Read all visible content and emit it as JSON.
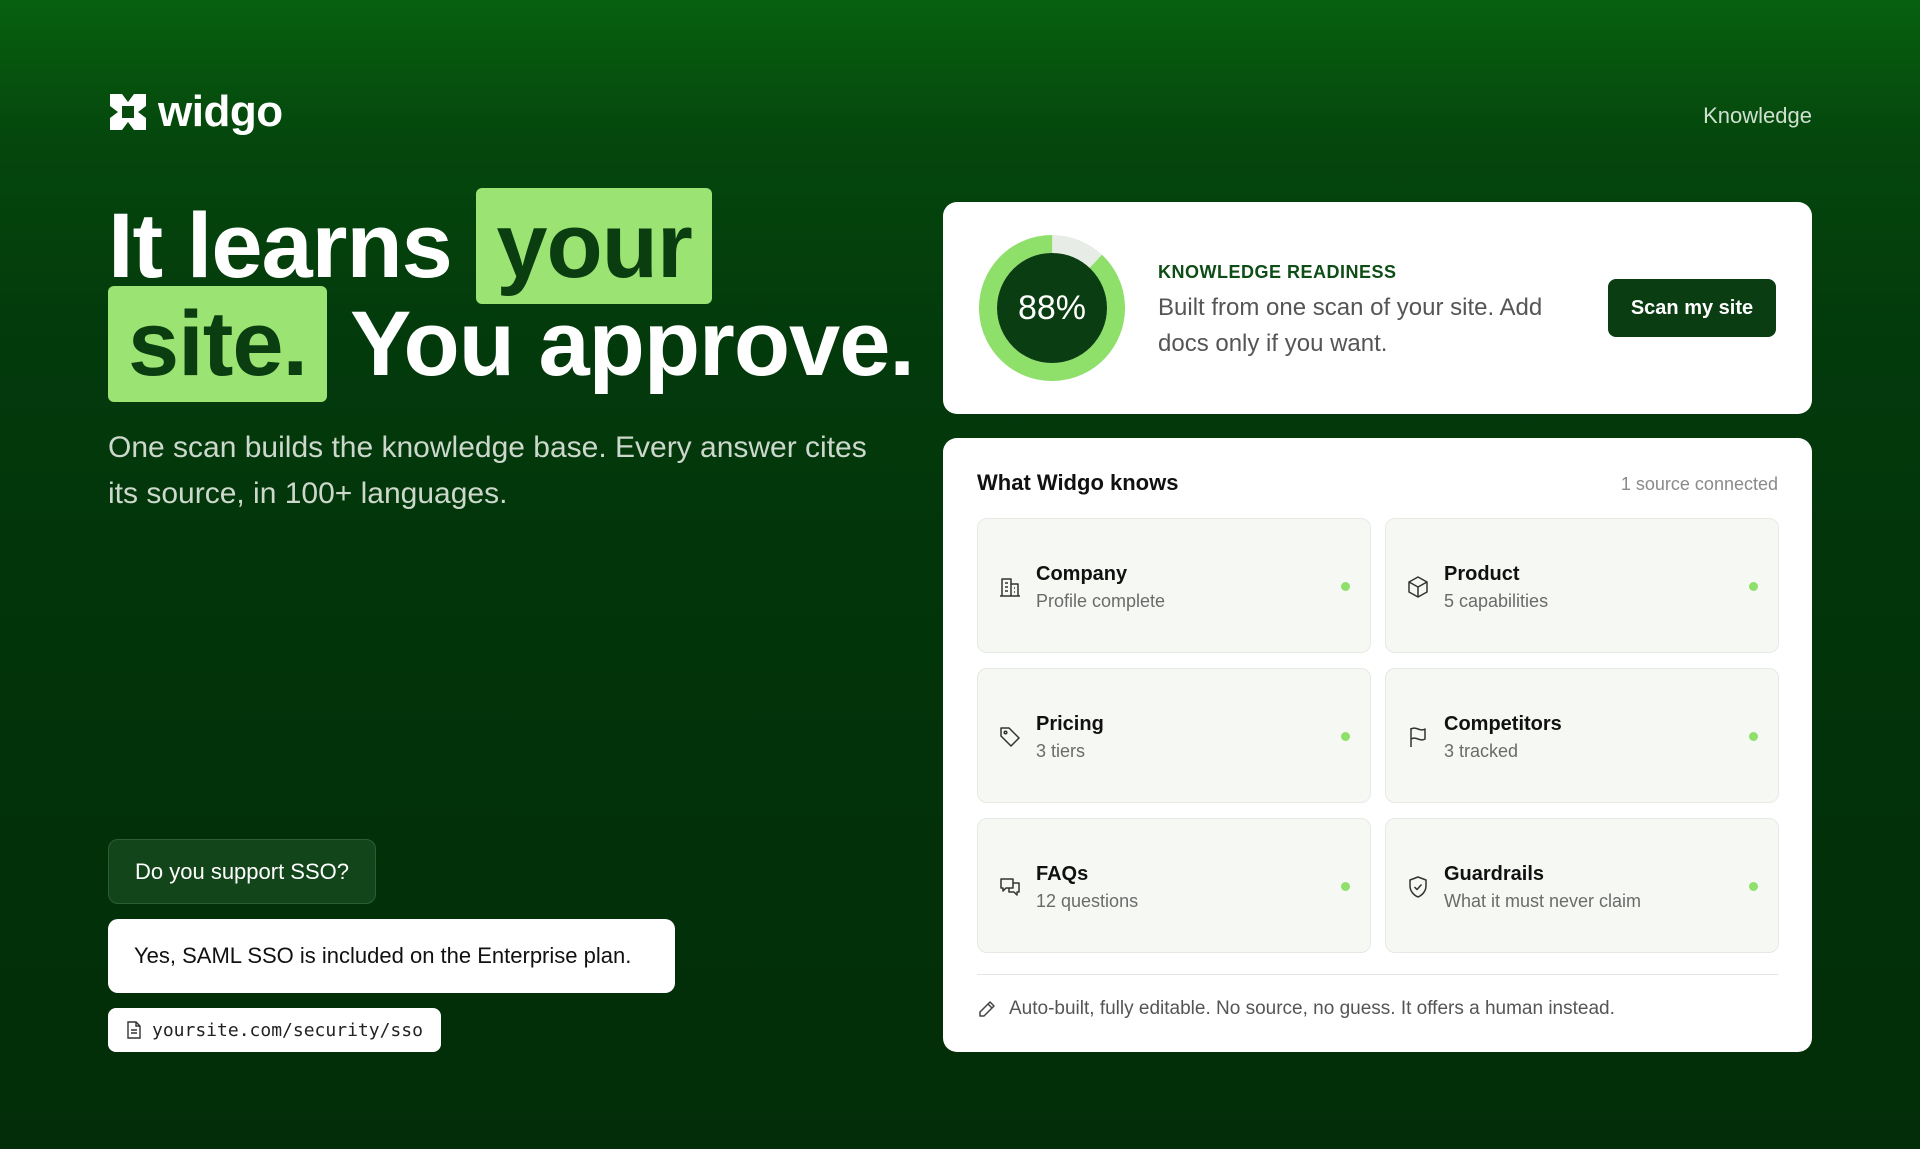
{
  "brand": {
    "name": "widgo",
    "icon": "widgo-logo-icon"
  },
  "nav": {
    "knowledge_label": "Knowledge"
  },
  "hero": {
    "headline_part1": "It learns ",
    "headline_highlight1": "your",
    "headline_highlight2": "site.",
    "headline_part2": " You approve.",
    "subheadline": "One scan builds the knowledge base. Every answer cites its source, in 100+ languages."
  },
  "chat": {
    "question": "Do you support SSO?",
    "answer": "Yes, SAML SSO is included on the Enterprise plan.",
    "source_url": "yoursite.com/security/sso",
    "source_icon": "document-icon"
  },
  "readiness": {
    "percent_label": "88%",
    "percent_value": 88,
    "title": "KNOWLEDGE READINESS",
    "description": "Built from one scan of your site. Add docs only if you want.",
    "button_label": "Scan my site"
  },
  "knows": {
    "title": "What Widgo knows",
    "source_count": "1 source connected",
    "items": [
      {
        "name": "Company",
        "sub": "Profile complete",
        "icon": "building-icon"
      },
      {
        "name": "Product",
        "sub": "5 capabilities",
        "icon": "box-icon"
      },
      {
        "name": "Pricing",
        "sub": "3 tiers",
        "icon": "tag-icon"
      },
      {
        "name": "Competitors",
        "sub": "3 tracked",
        "icon": "flag-icon"
      },
      {
        "name": "FAQs",
        "sub": "12 questions",
        "icon": "chat-icon"
      },
      {
        "name": "Guardrails",
        "sub": "What it must never claim",
        "icon": "shield-check-icon"
      }
    ],
    "footnote": "Auto-built, fully editable. No source, no guess. It offers a human instead.",
    "footnote_icon": "pencil-icon"
  },
  "colors": {
    "accent_green": "#9be474",
    "dark_green": "#0b3d12",
    "status_dot": "#8fe06b"
  }
}
